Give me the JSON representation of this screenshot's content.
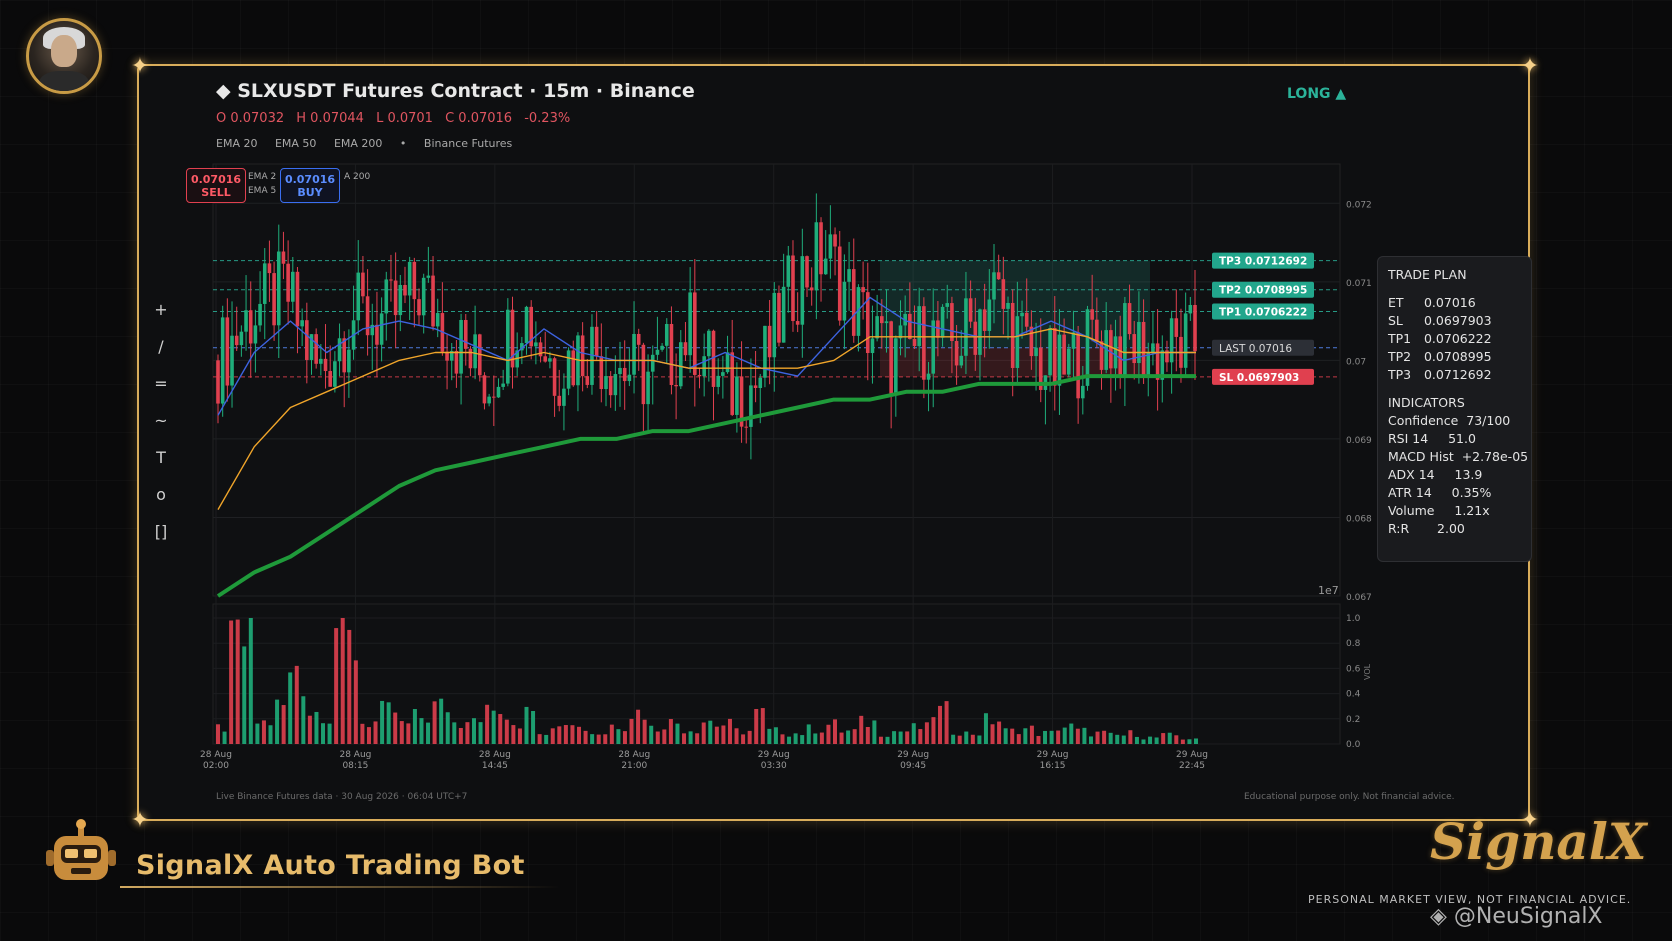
{
  "header": {
    "symbol_line": "◆  SLXUSDT Futures Contract  ·  15m  ·  Binance",
    "ohlc": {
      "open": "O 0.07032",
      "high": "H 0.07044",
      "low": "L 0.0701",
      "close": "C 0.07016",
      "change": "-0.23%"
    },
    "ema_labels": [
      "EMA 20",
      "EMA 50",
      "EMA 200",
      "•",
      "Binance Futures"
    ],
    "direction": "LONG ▲"
  },
  "order_buttons": {
    "sell_price": "0.07016",
    "sell_label": "SELL",
    "buy_price": "0.07016",
    "buy_label": "BUY",
    "mini_legend": [
      "EMA 2",
      "EMA 5",
      "A 200"
    ]
  },
  "toolbar": [
    "+",
    "/",
    "=",
    "~",
    "T",
    "o",
    "[]"
  ],
  "price_levels": {
    "tp3": "TP3  0.0712692",
    "tp2": "TP2  0.0708995",
    "tp1": "TP1  0.0706222",
    "last": "LAST  0.07016",
    "sl": "SL  0.0697903"
  },
  "trade_plan": {
    "title": "TRADE PLAN",
    "levels": [
      {
        "k": "ET",
        "v": "0.07016"
      },
      {
        "k": "SL",
        "v": "0.0697903"
      },
      {
        "k": "TP1",
        "v": "0.0706222"
      },
      {
        "k": "TP2",
        "v": "0.0708995"
      },
      {
        "k": "TP3",
        "v": "0.0712692"
      }
    ],
    "indicators_title": "INDICATORS",
    "indicators": [
      {
        "k": "Confidence",
        "v": "73/100"
      },
      {
        "k": "RSI 14",
        "v": "51.0"
      },
      {
        "k": "MACD Hist",
        "v": "+2.78e-05"
      },
      {
        "k": "ADX 14",
        "v": "13.9"
      },
      {
        "k": "ATR 14",
        "v": "0.35%"
      },
      {
        "k": "Volume",
        "v": "1.21x"
      },
      {
        "k": "R:R",
        "v": "2.00"
      }
    ]
  },
  "chart_data": {
    "type": "line",
    "price_axis": {
      "ylim": [
        0.067,
        0.0725
      ],
      "ticks": [
        "0.072",
        "0.071",
        "0.07",
        "0.069",
        "0.068",
        "0.067"
      ],
      "scale_label": "1e7"
    },
    "volume_axis": {
      "ylim": [
        0,
        1.0
      ],
      "ticks": [
        "1.0",
        "0.8",
        "0.6",
        "0.4",
        "0.2",
        "0.0"
      ],
      "label": "VOL"
    },
    "x_ticks": [
      {
        "date": "28 Aug",
        "time": "02:00"
      },
      {
        "date": "28 Aug",
        "time": "08:15"
      },
      {
        "date": "28 Aug",
        "time": "14:45"
      },
      {
        "date": "28 Aug",
        "time": "21:00"
      },
      {
        "date": "29 Aug",
        "time": "03:30"
      },
      {
        "date": "29 Aug",
        "time": "09:45"
      },
      {
        "date": "29 Aug",
        "time": "16:15"
      },
      {
        "date": "29 Aug",
        "time": "22:45"
      }
    ],
    "series": [
      {
        "name": "EMA 20",
        "color": "#3d63e0",
        "values": [
          0.0693,
          0.0701,
          0.0705,
          0.0701,
          0.0704,
          0.0705,
          0.0704,
          0.0702,
          0.07,
          0.0704,
          0.0701,
          0.07,
          0.07,
          0.0699,
          0.0701,
          0.0699,
          0.0698,
          0.0703,
          0.0708,
          0.0705,
          0.0704,
          0.0703,
          0.0703,
          0.0705,
          0.0703,
          0.07,
          0.0701,
          0.0701
        ]
      },
      {
        "name": "EMA 50",
        "color": "#f0a52a",
        "values": [
          0.0681,
          0.0689,
          0.0694,
          0.0696,
          0.0698,
          0.07,
          0.0701,
          0.0701,
          0.07,
          0.0701,
          0.07,
          0.07,
          0.07,
          0.0699,
          0.0699,
          0.0699,
          0.0699,
          0.07,
          0.0703,
          0.0703,
          0.0703,
          0.0703,
          0.0703,
          0.0704,
          0.0703,
          0.0701,
          0.0701,
          0.0701
        ]
      },
      {
        "name": "EMA 200",
        "color": "#1f9a3a",
        "values": [
          0.067,
          0.0673,
          0.0675,
          0.0678,
          0.0681,
          0.0684,
          0.0686,
          0.0687,
          0.0688,
          0.0689,
          0.069,
          0.069,
          0.0691,
          0.0691,
          0.0692,
          0.0693,
          0.0694,
          0.0695,
          0.0695,
          0.0696,
          0.0696,
          0.0697,
          0.0697,
          0.0697,
          0.0698,
          0.0698,
          0.0698,
          0.0698
        ]
      }
    ],
    "close_path": [
      0.07,
      0.0706,
      0.0709,
      0.0698,
      0.0706,
      0.0705,
      0.0709,
      0.0703,
      0.0697,
      0.0707,
      0.0699,
      0.0702,
      0.0699,
      0.0698,
      0.0704,
      0.0696,
      0.0697,
      0.0709,
      0.0714,
      0.0706,
      0.07,
      0.0703,
      0.0702,
      0.0709,
      0.0701,
      0.0698,
      0.0703,
      0.0702,
      0.0701,
      0.0702
    ],
    "volume_values": [
      0.15,
      0.95,
      0.2,
      0.35,
      0.6,
      0.3,
      0.25,
      0.92,
      0.2,
      0.3,
      0.18,
      0.25,
      0.35,
      0.2,
      0.28,
      0.3,
      0.18,
      0.4,
      0.12,
      0.25,
      0.15,
      0.1,
      0.18,
      0.3,
      0.15,
      0.2,
      0.14,
      0.22,
      0.18,
      0.12,
      0.28,
      0.12,
      0.1,
      0.14,
      0.18,
      0.12,
      0.2,
      0.1,
      0.12,
      0.15,
      0.3,
      0.12,
      0.1,
      0.22,
      0.12,
      0.14,
      0.1,
      0.16,
      0.12,
      0.1,
      0.08,
      0.1,
      0.06,
      0.08,
      0.05,
      0.04
    ],
    "colors": {
      "up": "#1fae7b",
      "down": "#e0404f",
      "tp_line": "#2bb39a",
      "sl_line": "#e0404f",
      "last_line": "#5b8dff"
    }
  },
  "footer": {
    "left": "Live Binance Futures data  ·  30 Aug 2026 · 06:04 UTC+7",
    "right": "Educational purpose only. Not financial advice."
  },
  "branding": {
    "bot_name": "SignalX Auto Trading Bot",
    "brand": "SignalX",
    "disclaimer": "PERSONAL MARKET VIEW, NOT FINANCIAL ADVICE.",
    "watermark": "◈ @NeuSignalX"
  }
}
